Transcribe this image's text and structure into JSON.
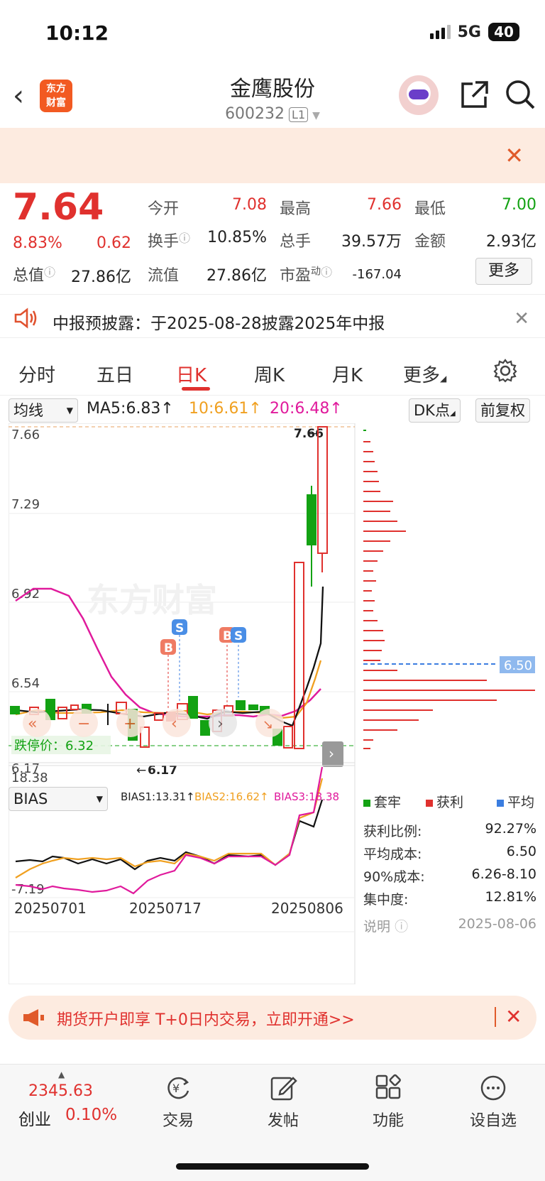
{
  "status": {
    "time": "10:12",
    "network": "5G",
    "battery": "40"
  },
  "header": {
    "logo_text": "东方财富",
    "stock_name": "金鹰股份",
    "stock_code": "600232",
    "level": "L1"
  },
  "quote": {
    "price": "7.64",
    "change_pct": "8.83%",
    "change": "0.62",
    "total_value_label": "总值",
    "total_value": "27.86亿",
    "fields": {
      "open_label": "今开",
      "open": "7.08",
      "high_label": "最高",
      "high": "7.66",
      "low_label": "最低",
      "low": "7.00",
      "turnover_label": "换手",
      "turnover": "10.85%",
      "volume_label": "总手",
      "volume": "39.57万",
      "amount_label": "金额",
      "amount": "2.93亿",
      "float_label": "流值",
      "float_value": "27.86亿",
      "pe_label": "市盈",
      "pe_sup": "动",
      "pe": "-167.04"
    },
    "more_label": "更多"
  },
  "notice": {
    "text": "中报预披露：于2025-08-28披露2025年中报"
  },
  "tabs": [
    "分时",
    "五日",
    "日K",
    "周K",
    "月K",
    "更多"
  ],
  "active_tab": "日K",
  "indicators": {
    "ma_select": "均线",
    "ma5": "MA5:6.83↑",
    "ma10": "10:6.61↑",
    "ma20": "20:6.48↑",
    "dk_label": "DK点",
    "adjust_label": "前复权"
  },
  "kchart": {
    "y_labels": [
      "7.66",
      "7.29",
      "6.92",
      "6.54",
      "6.17"
    ],
    "high_marker": "7.66",
    "low_marker": "6.17",
    "limit_down": "跌停价：6.32",
    "cost_marker": "6.50",
    "watermark": "东方财富",
    "signals": [
      "B",
      "S",
      "B",
      "S"
    ]
  },
  "bias": {
    "select": "BIAS",
    "bias1": "BIAS1:13.31↑",
    "bias2": "BIAS2:16.62↑",
    "bias3": "BIAS3:18.38",
    "y_top": "18.38",
    "y_bottom": "-7.19",
    "dates": [
      "20250701",
      "20250717",
      "20250806"
    ]
  },
  "chip_stats": {
    "legend": [
      "套牢",
      "获利",
      "平均"
    ],
    "rows": [
      {
        "label": "获利比例:",
        "value": "92.27%"
      },
      {
        "label": "平均成本:",
        "value": "6.50"
      },
      {
        "label": "90%成本:",
        "value": "6.26-8.10"
      },
      {
        "label": "集中度:",
        "value": "12.81%"
      }
    ],
    "note_label": "说明",
    "note_date": "2025-08-06"
  },
  "ad": {
    "text": "期货开户即享 T+0日内交易，立即开通>>"
  },
  "bottom": {
    "index_value": "2345.63",
    "index_name": "创业",
    "index_pct": "0.10%",
    "nav": [
      "交易",
      "发帖",
      "功能",
      "设自选"
    ]
  },
  "colors": {
    "up": "#e0312e",
    "down": "#13a213",
    "ma5": "#111111",
    "ma10": "#f0a020",
    "ma20": "#e01a9c",
    "avg": "#3b7de0"
  }
}
